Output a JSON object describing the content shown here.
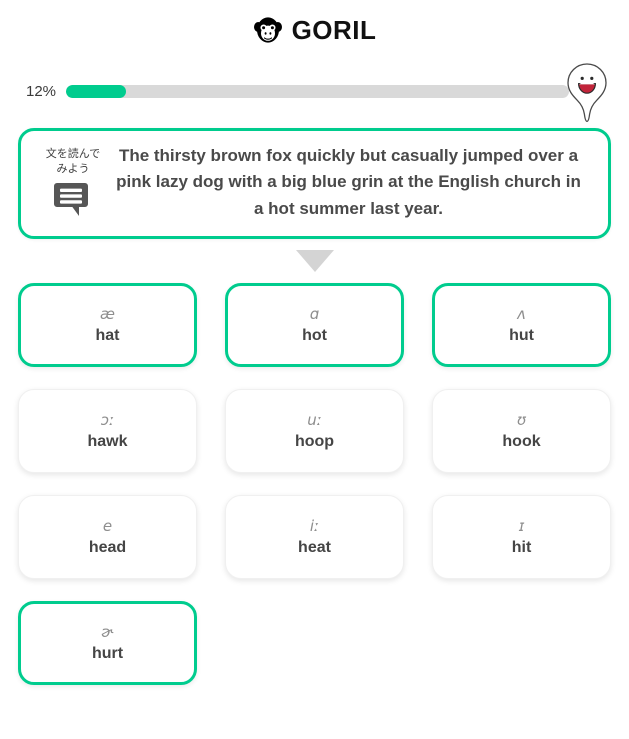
{
  "brand": {
    "name": "GORIL",
    "logo_icon": "gorilla-face-icon",
    "accent_color": "#00cc8e"
  },
  "progress": {
    "percent_label": "12%",
    "percent_value": 12,
    "fill_color": "#00cc8e",
    "track_color": "#d9d9d9",
    "mascot_icon": "mascot-open-mouth-icon"
  },
  "sentence_card": {
    "aside_label": "文を読んで\nみよう",
    "aside_icon": "speech-bubble-icon",
    "text": "The thirsty brown fox quickly but casually jumped over a pink lazy dog with a big blue grin at the English church in a hot summer last year.",
    "border_color": "#00cc8e"
  },
  "arrow": {
    "icon": "chevron-down-triangle-icon",
    "color": "#d4d4d4"
  },
  "phoneme_grid": {
    "cards": [
      {
        "ipa": "æ",
        "word": "hat",
        "selected": true
      },
      {
        "ipa": "ɑ",
        "word": "hot",
        "selected": true
      },
      {
        "ipa": "ʌ",
        "word": "hut",
        "selected": true
      },
      {
        "ipa": "ɔː",
        "word": "hawk",
        "selected": false
      },
      {
        "ipa": "uː",
        "word": "hoop",
        "selected": false
      },
      {
        "ipa": "ʊ",
        "word": "hook",
        "selected": false
      },
      {
        "ipa": "e",
        "word": "head",
        "selected": false
      },
      {
        "ipa": "iː",
        "word": "heat",
        "selected": false
      },
      {
        "ipa": "ɪ",
        "word": "hit",
        "selected": false
      },
      {
        "ipa": "ɚ",
        "word": "hurt",
        "selected": true
      }
    ]
  }
}
